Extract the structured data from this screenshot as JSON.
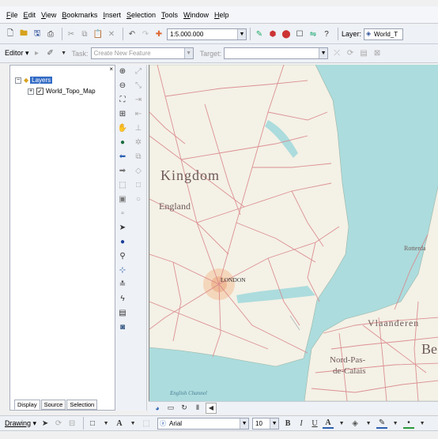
{
  "menu": [
    {
      "label": "File",
      "mnemonic": "F"
    },
    {
      "label": "Edit",
      "mnemonic": "E"
    },
    {
      "label": "View",
      "mnemonic": "V"
    },
    {
      "label": "Bookmarks",
      "mnemonic": "B"
    },
    {
      "label": "Insert",
      "mnemonic": "I"
    },
    {
      "label": "Selection",
      "mnemonic": "S"
    },
    {
      "label": "Tools",
      "mnemonic": "T"
    },
    {
      "label": "Window",
      "mnemonic": "W"
    },
    {
      "label": "Help",
      "mnemonic": "H"
    }
  ],
  "standard_toolbar": {
    "scale_value": "1:5.000.000",
    "layer_label": "Layer:",
    "layer_value": "World_T"
  },
  "editor_toolbar": {
    "editor_label": "Editor",
    "task_label": "Task:",
    "task_value": "Create New Feature",
    "target_label": "Target:",
    "target_value": ""
  },
  "toc": {
    "root_label": "Layers",
    "layer_name": "World_Topo_Map",
    "tabs": [
      "Display",
      "Source",
      "Selection"
    ]
  },
  "map_labels": {
    "kingdom": "Kingdom",
    "england": "England",
    "london": "LONDON",
    "rotterdam": "Rotterda",
    "vlaanderen": "Vlaanderen",
    "be": "Be",
    "nord_pas_1": "Nord-Pas-",
    "nord_pas_2": "de-Calais",
    "channel": "English Channel"
  },
  "drawing_toolbar": {
    "drawing_label": "Drawing",
    "font_value": "Arial",
    "font_size": "10"
  },
  "colors": {
    "water": "#acdcdd",
    "land": "#f4f1e6",
    "road": "#d9868a",
    "label": "#6e5a5a"
  }
}
